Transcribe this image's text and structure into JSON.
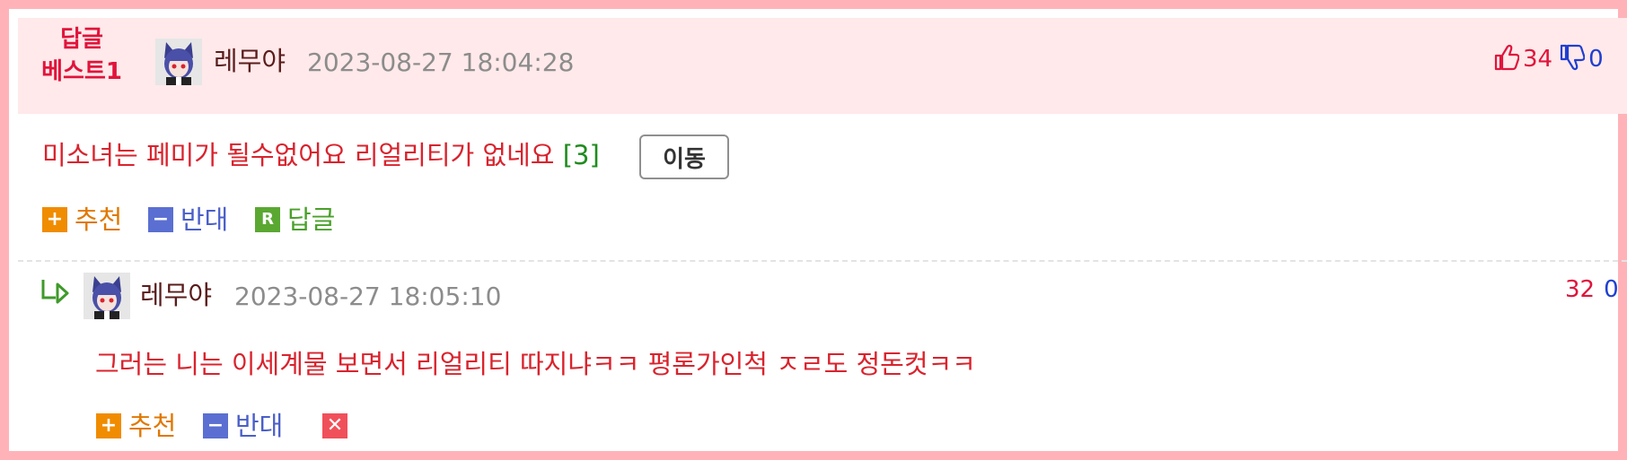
{
  "best_comment": {
    "label_line1": "답글",
    "label_line2": "베스트1",
    "author": "레무야",
    "datetime": "2023-08-27 18:04:28",
    "upvotes": "34",
    "downvotes": "0",
    "text": "미소녀는 페미가 될수없어요 리얼리티가 없네요",
    "reply_count": "[3]",
    "move_button": "이동",
    "actions": {
      "recommend": "추천",
      "oppose": "반대",
      "reply": "답글"
    }
  },
  "reply_comment": {
    "author": "레무야",
    "datetime": "2023-08-27 18:05:10",
    "upvotes": "32",
    "downvotes": "0",
    "text": "그러는 니는 이세계물 보면서 리얼리티 따지냐ㅋㅋ 평론가인척 ㅈㄹ도 정돈컷ㅋㅋ",
    "actions": {
      "recommend": "추천",
      "oppose": "반대"
    }
  },
  "icons": {
    "thumbs_up": "thumbs-up-icon",
    "thumbs_down": "thumbs-down-icon",
    "reply_arrow": "reply-arrow-icon",
    "plus": "plus-icon",
    "minus": "minus-icon",
    "reply_badge": "reply-badge-icon",
    "delete": "delete-icon"
  },
  "colors": {
    "frame_border": "#ffb3b8",
    "best_header_bg": "#ffe9ea",
    "best_label": "#e0143c",
    "comment_text": "#d9232d",
    "reply_count": "#1f8c1f",
    "upvote": "#e0143c",
    "downvote": "#1f3fd1"
  }
}
